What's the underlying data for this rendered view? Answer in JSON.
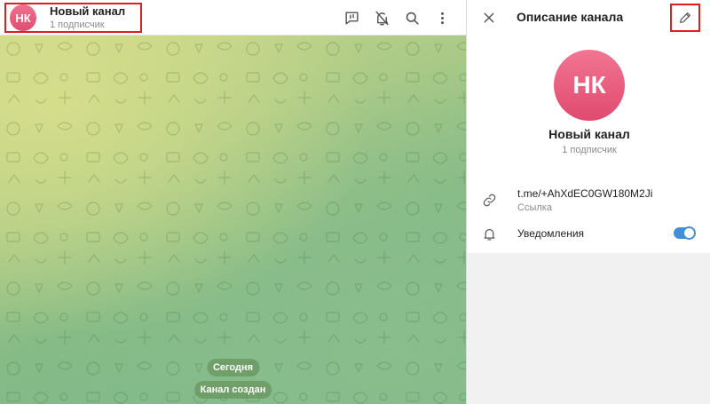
{
  "chat": {
    "channel_name": "Новый канал",
    "avatar_initials": "НК",
    "subscribers": "1 подписчик",
    "icons": [
      "discussion-icon",
      "bell-off-icon",
      "search-icon",
      "more-vertical-icon"
    ],
    "service_messages": {
      "date": "Сегодня",
      "created": "Канал создан"
    }
  },
  "panel": {
    "title": "Описание канала",
    "avatar_initials": "НК",
    "channel_name": "Новый канал",
    "subscribers": "1 подписчик",
    "link": {
      "value": "t.me/+AhXdEC0GW180M2Ji",
      "caption": "Ссылка"
    },
    "notifications": {
      "label": "Уведомления",
      "enabled": true
    }
  },
  "colors": {
    "accent": "#3f8fd9",
    "avatar": "#e85a7c",
    "highlight": "#e01e1e"
  }
}
